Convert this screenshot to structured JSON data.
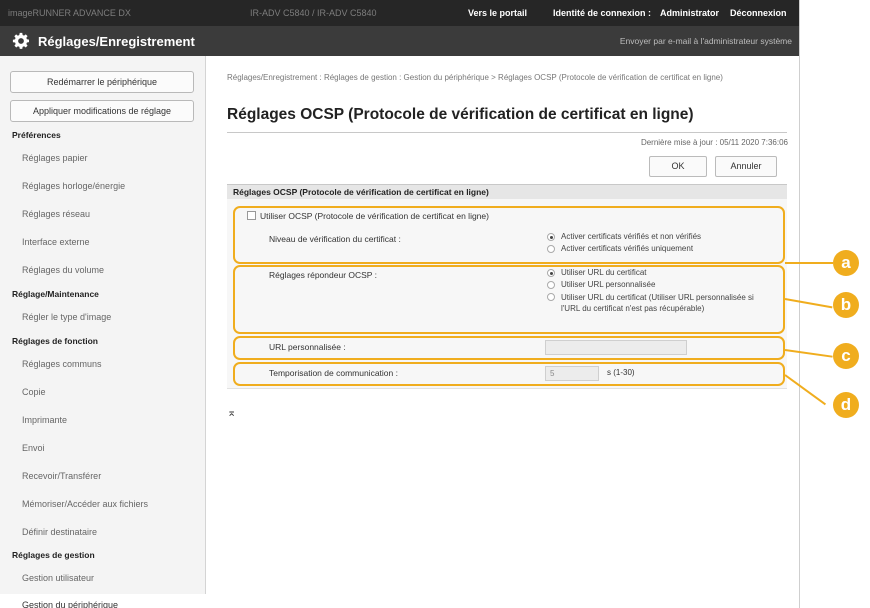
{
  "header": {
    "host": "imageRUNNER ADVANCE DX",
    "host_id": "IR-ADV C5840 / IR-ADV C5840",
    "portal_link": "Vers le portail",
    "login_id_label": "Identité de connexion :",
    "login_user": "Administrator",
    "logout": "Déconnexion"
  },
  "titlebar": {
    "title": "Réglages/Enregistrement",
    "mail_link": "Envoyer par e-mail à l'administrateur système",
    "icon": "gear-icon"
  },
  "sidebar": {
    "restart_button": "Redémarrer le périphérique",
    "apply_button": "Appliquer modifications de réglage",
    "sections": [
      {
        "title": "Préférences",
        "items": [
          "Réglages papier",
          "Réglages horloge/énergie",
          "Réglages réseau",
          "Interface externe",
          "Réglages du volume"
        ]
      },
      {
        "title": "Réglage/Maintenance",
        "items": [
          "Régler le type d'image"
        ]
      },
      {
        "title": "Réglages de fonction",
        "items": [
          "Réglages communs",
          "Copie",
          "Imprimante",
          "Envoi",
          "Recevoir/Transférer",
          "Mémoriser/Accéder aux fichiers",
          "Définir destinataire"
        ]
      },
      {
        "title": "Réglages de gestion",
        "items": [
          "Gestion utilisateur",
          "Gestion du périphérique"
        ]
      }
    ]
  },
  "main": {
    "breadcrumb": "Réglages/Enregistrement : Réglages de gestion : Gestion du périphérique > Réglages OCSP (Protocole de vérification de certificat en ligne)",
    "page_title": "Réglages OCSP (Protocole de vérification de certificat en ligne)",
    "last_updated": "Dernière mise à jour : 05/11 2020 7:36:06",
    "ok_button": "OK",
    "cancel_button": "Annuler",
    "panel_title": "Réglages OCSP (Protocole de vérification de certificat en ligne)",
    "use_ocsp_label": "Utiliser OCSP (Protocole de vérification de certificat en ligne)",
    "use_ocsp_checked": false,
    "verify_level_label": "Niveau de vérification du certificat :",
    "verify_level_options": [
      "Activer certificats vérifiés et non vérifiés",
      "Activer certificats vérifiés uniquement"
    ],
    "verify_level_selected": 0,
    "responder_label": "Réglages répondeur OCSP :",
    "responder_options": [
      "Utiliser URL du certificat",
      "Utiliser URL personnalisée",
      "Utiliser URL du certificat (Utiliser URL personnalisée si l'URL du certificat n'est pas récupérable)"
    ],
    "responder_selected": 0,
    "custom_url_label": "URL personnalisée :",
    "custom_url_value": "",
    "timeout_label": "Temporisation de communication :",
    "timeout_value": "5",
    "timeout_unit": "s (1-30)",
    "back_to_top": "⌅"
  },
  "callouts": [
    "a",
    "b",
    "c",
    "d"
  ],
  "colors": {
    "accent": "#f0ad1e",
    "topbar": "#262626",
    "titlebar": "#3b3b3b"
  }
}
